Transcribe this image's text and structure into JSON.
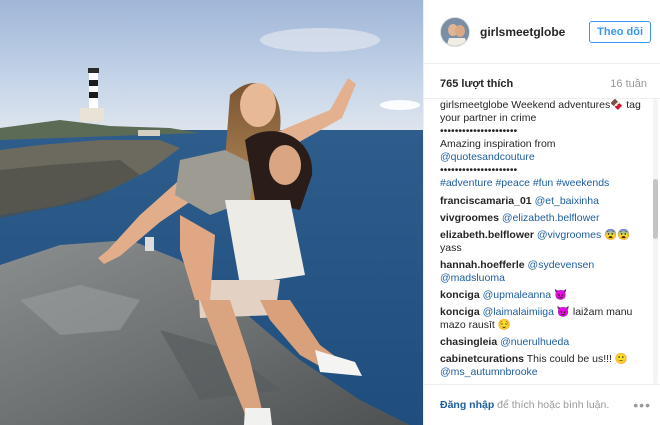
{
  "header": {
    "username": "girlsmeetglobe",
    "follow_label": "Theo dõi"
  },
  "stats": {
    "likes": "765 lượt thích",
    "age": "16 tuần"
  },
  "caption": {
    "username": "girlsmeetglobe",
    "text": "Weekend adventures🍫 tag your partner in crime",
    "dots1": "•••••••••••••••••••••",
    "line2": "Amazing inspiration from",
    "mention": "@quotesandcouture",
    "dots2": "•••••••••••••••••••••",
    "hashtags": "#adventure #peace #fun #weekends"
  },
  "comments": [
    {
      "user": "franciscamaria_01",
      "mention": "@et_baixinha",
      "text": ""
    },
    {
      "user": "vivgroomes",
      "mention": "@elizabeth.belflower",
      "text": ""
    },
    {
      "user": "elizabeth.belflower",
      "mention": "@vivgroomes",
      "text": " 😨😨 yass"
    },
    {
      "user": "hannah.hoefferle",
      "mention": "@sydevensen @madsluoma",
      "text": ""
    },
    {
      "user": "konciga",
      "mention": "@upmaleanna",
      "text": " 😈"
    },
    {
      "user": "konciga",
      "mention": "@laimalaimiiga",
      "text": " 😈 laižam manu mazo rausīt 😌"
    },
    {
      "user": "chasingleia",
      "mention": "@nuerulhueda",
      "text": ""
    },
    {
      "user": "cabinetcurations",
      "mention": "",
      "text": " This could be us!!! 🙂",
      "mention2": "@ms_autumnbrooke"
    }
  ],
  "footer": {
    "login_link": "Đăng nhập",
    "login_rest": " để thích hoặc bình luận.",
    "more": "•••"
  }
}
